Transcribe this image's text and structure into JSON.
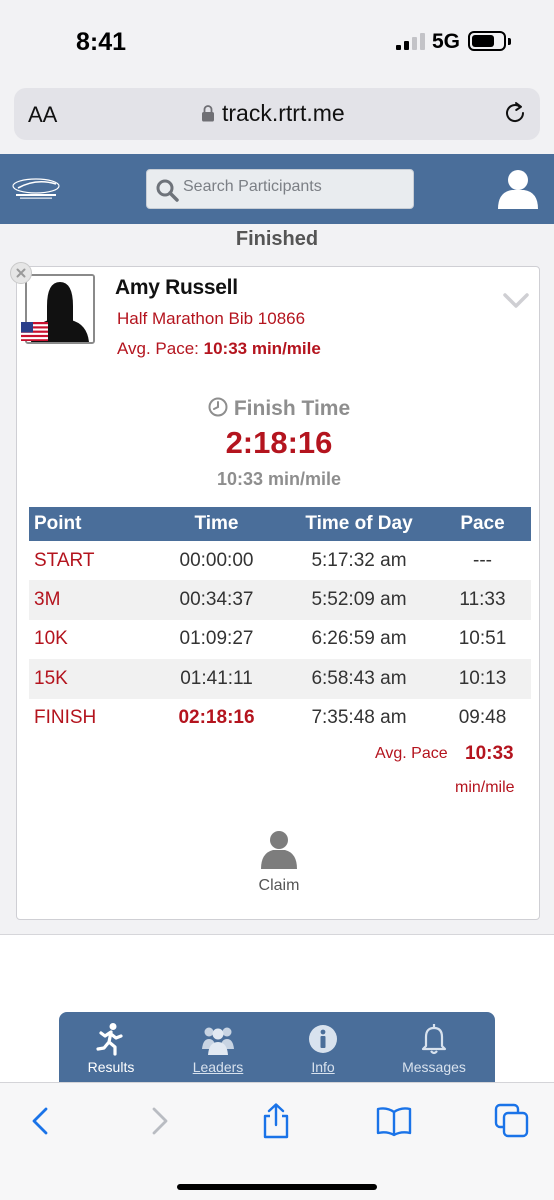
{
  "status_bar": {
    "time": "8:41",
    "network": "5G"
  },
  "browser": {
    "text_size_label": "AA",
    "url": "track.rtrt.me"
  },
  "header": {
    "search_placeholder": "Search Participants"
  },
  "result_status": "Finished",
  "athlete": {
    "name": "Amy Russell",
    "race_line": "Half Marathon Bib 10866",
    "avg_pace_label": "Avg. Pace:",
    "avg_pace_value": "10:33 min/mile"
  },
  "finish": {
    "label": "Finish Time",
    "time": "2:18:16",
    "pace": "10:33 min/mile"
  },
  "splits": {
    "headers": [
      "Point",
      "Time",
      "Time of Day",
      "Pace"
    ],
    "rows": [
      [
        "START",
        "00:00:00",
        "5:17:32 am",
        "---"
      ],
      [
        "3M",
        "00:34:37",
        "5:52:09 am",
        "11:33"
      ],
      [
        "10K",
        "01:09:27",
        "6:26:59 am",
        "10:51"
      ],
      [
        "15K",
        "01:41:11",
        "6:58:43 am",
        "10:13"
      ],
      [
        "FINISH",
        "02:18:16",
        "7:35:48 am",
        "09:48"
      ]
    ],
    "avg_pace_label": "Avg. Pace",
    "avg_pace_value": "10:33",
    "avg_pace_unit": "min/mile"
  },
  "claim_label": "Claim",
  "bottom_nav": [
    {
      "label": "Results",
      "icon": "runner-icon"
    },
    {
      "label": "Leaders",
      "icon": "group-icon"
    },
    {
      "label": "Info",
      "icon": "info-icon"
    },
    {
      "label": "Messages",
      "icon": "bell-icon"
    }
  ],
  "colors": {
    "brand_blue": "#4a6e9a",
    "accent_red": "#b4141e"
  }
}
